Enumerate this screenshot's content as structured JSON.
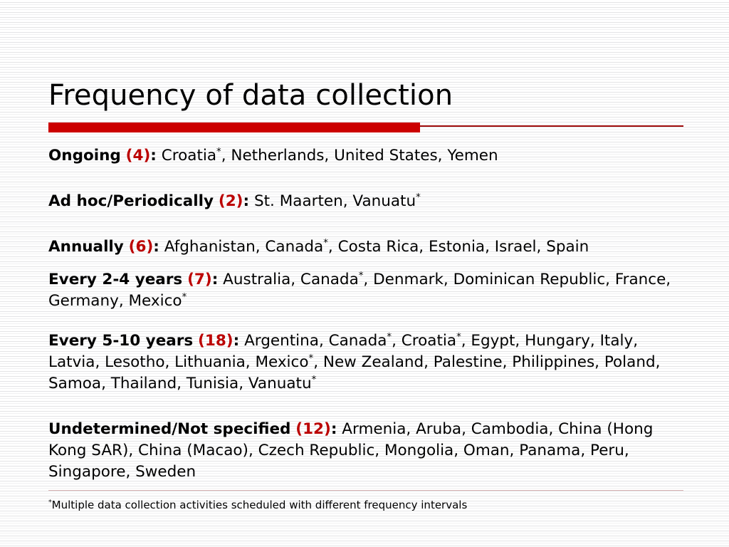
{
  "slide": {
    "title": "Frequency of data collection",
    "accent_color": "#cc0000",
    "accent_dark": "#9e0b0b",
    "footnote_rule_color": "#d9b3b3",
    "text_color": "#000000"
  },
  "entries": [
    {
      "label": "Ongoing",
      "count": "(4)",
      "colon": ":",
      "countries_pre": "Croatia",
      "countries_post": ", Netherlands, United States, Yemen",
      "countries_full": "Croatia*, Netherlands, United States, Yemen"
    },
    {
      "label": "Ad hoc/Periodically",
      "count": "(2)",
      "colon": ":",
      "countries_full": "St. Maarten, Vanuatu*"
    },
    {
      "label": "Annually",
      "count": "(6)",
      "colon": ":",
      "countries_full": "Afghanistan, Canada*, Costa Rica, Estonia, Israel, Spain"
    },
    {
      "label": "Every 2-4 years",
      "count": "(7)",
      "colon": ":",
      "countries_full": "Australia, Canada*, Denmark, Dominican Republic, France, Germany, Mexico*"
    },
    {
      "label": "Every 5-10 years",
      "count": "(18)",
      "colon": ":",
      "countries_full": "Argentina, Canada*, Croatia*, Egypt, Hungary, Italy, Latvia, Lesotho, Lithuania, Mexico*, New Zealand, Palestine, Philippines, Poland, Samoa, Thailand, Tunisia, Vanuatu*"
    },
    {
      "label": "Undetermined/Not specified",
      "count": "(12)",
      "colon": ":",
      "countries_full": "Armenia, Aruba, Cambodia, China (Hong Kong SAR), China (Macao), Czech Republic, Mongolia, Oman, Panama, Peru, Singapore, Sweden"
    }
  ],
  "footnote": {
    "marker": "*",
    "text": "Multiple data collection activities scheduled with different frequency intervals"
  }
}
